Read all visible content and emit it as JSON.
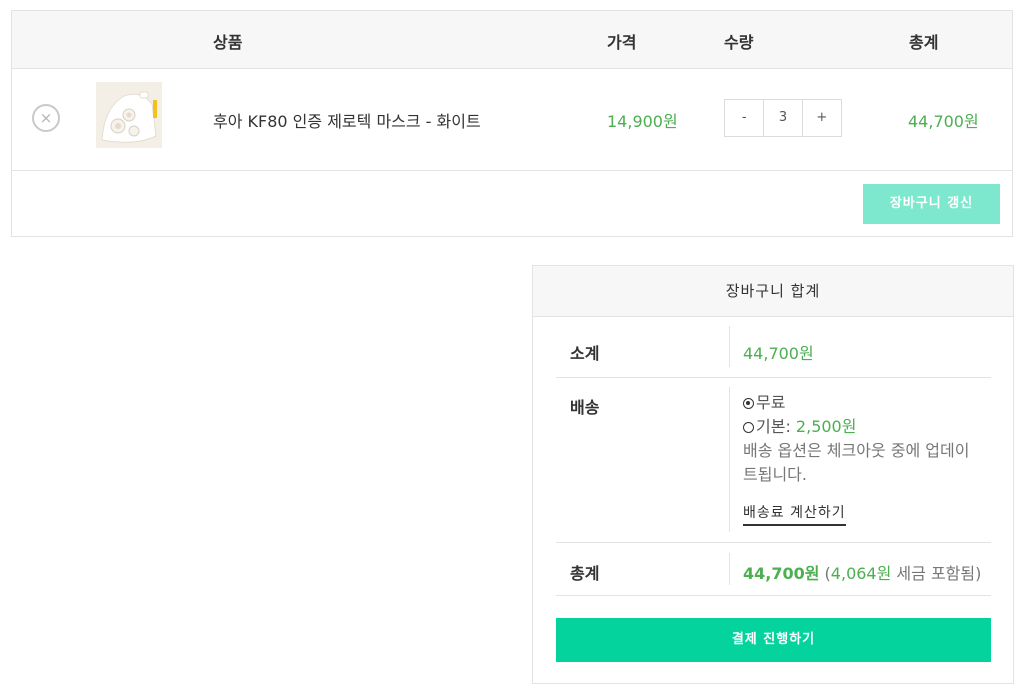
{
  "cart_table": {
    "headers": {
      "product": "상품",
      "price": "가격",
      "quantity": "수량",
      "total": "총계"
    },
    "item": {
      "remove_symbol": "×",
      "name": "후아 KF80 인증 제로텍 마스크 - 화이트",
      "price": "14,900원",
      "qty_minus": "-",
      "qty_value": "3",
      "qty_plus": "+",
      "line_total": "44,700원"
    },
    "update_button": "장바구니 갱신"
  },
  "cart_totals": {
    "title": "장바구니 합계",
    "subtotal_label": "소계",
    "subtotal_value": "44,700원",
    "shipping_label": "배송",
    "shipping_options": [
      {
        "label": "무료",
        "amount": "",
        "selected": true
      },
      {
        "label": "기본: ",
        "amount": "2,500원",
        "selected": false
      }
    ],
    "shipping_note": "배송 옵션은 체크아웃 중에 업데이트됩니다.",
    "shipping_calc_link": "배송료 계산하기",
    "total_label": "총계",
    "total_value": "44,700원",
    "tax_open": " (",
    "tax_amount": "4,064원",
    "tax_suffix": " 세금 포함됨)",
    "checkout_button": "결제 진행하기"
  },
  "colors": {
    "accent_green": "#4caf50",
    "checkout_bg": "#05d39d",
    "update_bg": "#7ee8cf"
  }
}
